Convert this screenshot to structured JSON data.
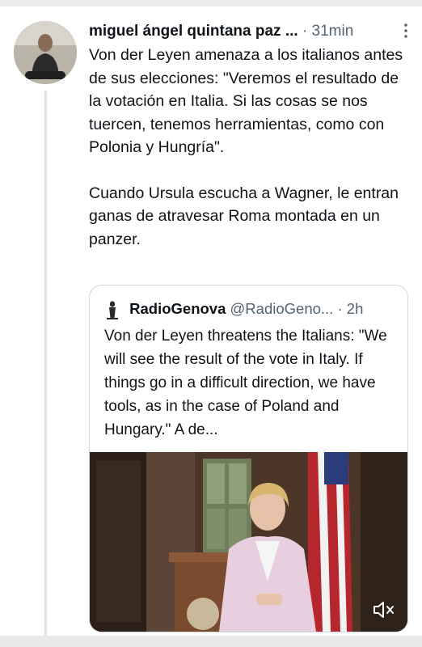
{
  "tweet": {
    "author_name": "miguel ángel quintana paz",
    "author_suffix": "...",
    "separator": "·",
    "time": "31min",
    "paragraphs": [
      "Von der Leyen amenaza a los italianos antes de sus elecciones: \"Veremos el resultado de la votación en Italia. Si las cosas se nos tuercen, tenemos herramientas, como con Polonia y Hungría\".",
      "Cuando Ursula escucha a Wagner, le entran ganas de atravesar Roma montada en un panzer."
    ]
  },
  "quoted_tweet": {
    "author_name": "RadioGenova",
    "handle": "@RadioGeno...",
    "separator": "·",
    "time": "2h",
    "text": "Von der Leyen threatens the Italians: \"We will see the result of the vote in Italy. If things go in a difficult direction, we have tools, as in the case of Poland and Hungary.\" A de..."
  },
  "icons": {
    "more": "more-vertical-icon",
    "mute": "mute-icon"
  },
  "colors": {
    "text": "#0f1419",
    "muted": "#536471",
    "border": "#cfd9de"
  }
}
